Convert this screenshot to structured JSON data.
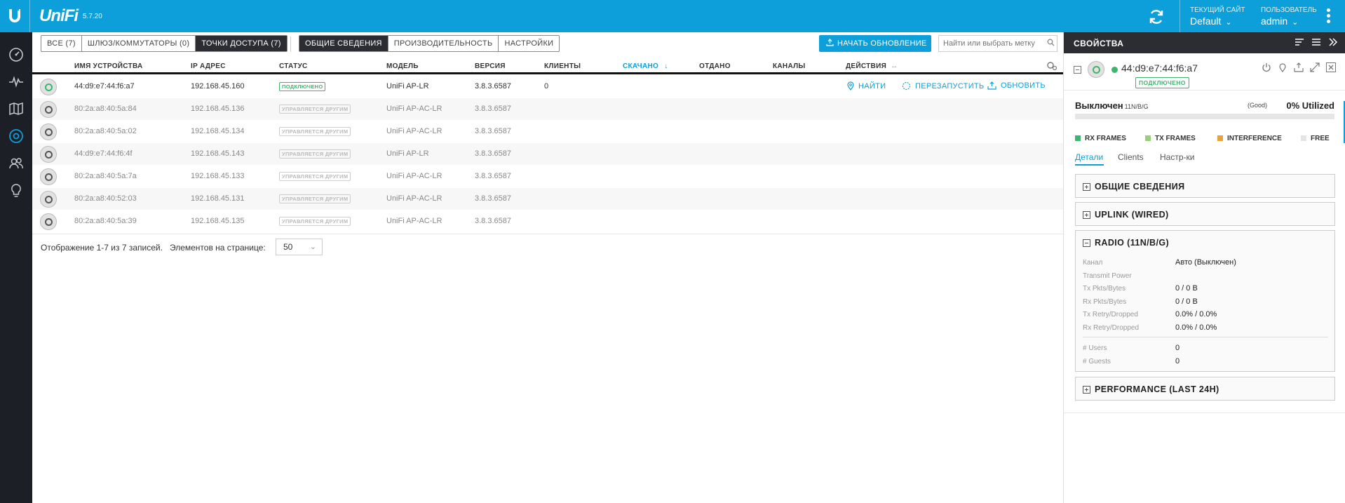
{
  "header": {
    "brand": "UniFi",
    "version": "5.7.20",
    "site_label": "ТЕКУЩИЙ САЙТ",
    "site_value": "Default",
    "user_label": "ПОЛЬЗОВАТЕЛЬ",
    "user_value": "admin"
  },
  "filters": [
    {
      "label": "ВСЕ (7)",
      "active": false
    },
    {
      "label": "ШЛЮЗ/КОММУТАТОРЫ (0)",
      "active": false
    },
    {
      "label": "ТОЧКИ ДОСТУПА (7)",
      "active": true
    }
  ],
  "views": [
    {
      "label": "ОБЩИЕ СВЕДЕНИЯ",
      "active": true
    },
    {
      "label": "ПРОИЗВОДИТЕЛЬНОСТЬ",
      "active": false
    },
    {
      "label": "НАСТРОЙКИ",
      "active": false
    }
  ],
  "toolbar": {
    "upgrade_label": "НАЧАТЬ ОБНОВЛЕНИЕ",
    "search_placeholder": "Найти или выбрать метку"
  },
  "columns": {
    "name": "ИМЯ УСТРОЙСТВА",
    "ip": "IP АДРЕС",
    "status": "СТАТУС",
    "model": "МОДЕЛЬ",
    "version": "ВЕРСИЯ",
    "clients": "КЛИЕНТЫ",
    "downloaded": "СКАЧАНО",
    "sent": "ОТДАНО",
    "channels": "КАНАЛЫ",
    "actions": "ДЕЙСТВИЯ"
  },
  "rows": [
    {
      "name": "44:d9:e7:44:f6:a7",
      "ip": "192.168.45.160",
      "status": "ПОДКЛЮЧЕНО",
      "connected": true,
      "model": "UniFi AP-LR",
      "version": "3.8.3.6587",
      "clients": "0"
    },
    {
      "name": "80:2a:a8:40:5a:84",
      "ip": "192.168.45.136",
      "status": "УПРАВЛЯЕТСЯ ДРУГИМ",
      "connected": false,
      "model": "UniFi AP-AC-LR",
      "version": "3.8.3.6587",
      "clients": ""
    },
    {
      "name": "80:2a:a8:40:5a:02",
      "ip": "192.168.45.134",
      "status": "УПРАВЛЯЕТСЯ ДРУГИМ",
      "connected": false,
      "model": "UniFi AP-AC-LR",
      "version": "3.8.3.6587",
      "clients": ""
    },
    {
      "name": "44:d9:e7:44:f6:4f",
      "ip": "192.168.45.143",
      "status": "УПРАВЛЯЕТСЯ ДРУГИМ",
      "connected": false,
      "model": "UniFi AP-LR",
      "version": "3.8.3.6587",
      "clients": ""
    },
    {
      "name": "80:2a:a8:40:5a:7a",
      "ip": "192.168.45.133",
      "status": "УПРАВЛЯЕТСЯ ДРУГИМ",
      "connected": false,
      "model": "UniFi AP-AC-LR",
      "version": "3.8.3.6587",
      "clients": ""
    },
    {
      "name": "80:2a:a8:40:52:03",
      "ip": "192.168.45.131",
      "status": "УПРАВЛЯЕТСЯ ДРУГИМ",
      "connected": false,
      "model": "UniFi AP-AC-LR",
      "version": "3.8.3.6587",
      "clients": ""
    },
    {
      "name": "80:2a:a8:40:5a:39",
      "ip": "192.168.45.135",
      "status": "УПРАВЛЯЕТСЯ ДРУГИМ",
      "connected": false,
      "model": "UniFi AP-AC-LR",
      "version": "3.8.3.6587",
      "clients": ""
    }
  ],
  "row_actions": {
    "locate": "НАЙТИ",
    "restart": "ПЕРЕЗАПУСТИТЬ",
    "upgrade": "ОБНОВИТЬ"
  },
  "pager": {
    "summary": "Отображение 1-7 из 7 записей.",
    "per_page_label": "Элементов на странице:",
    "per_page_value": "50"
  },
  "panel": {
    "title": "СВОЙСТВА",
    "device_mac": "44:d9:e7:44:f6:a7",
    "device_status": "ПОДКЛЮЧЕНО",
    "radio_state": "Выключен",
    "radio_band": "11N/B/G",
    "quality": "(Good)",
    "utilization": "0% Utilized",
    "utilization_value": 0,
    "legend": [
      {
        "label": "RX FRAMES",
        "color": "#3db56c"
      },
      {
        "label": "TX FRAMES",
        "color": "#9ad07a"
      },
      {
        "label": "INTERFERENCE",
        "color": "#e8a23a"
      },
      {
        "label": "FREE",
        "color": "#e4e4e4"
      }
    ],
    "tabs": [
      "Детали",
      "Clients",
      "Настр-ки"
    ],
    "sections": {
      "overview": "ОБЩИЕ СВЕДЕНИЯ",
      "uplink": "UPLINK (WIRED)",
      "radio": "RADIO (11N/B/G)",
      "performance": "PERFORMANCE (LAST 24H)"
    },
    "radio_details": [
      {
        "key": "Канал",
        "value": "Авто (Выключен)"
      },
      {
        "key": "Transmit Power",
        "value": ""
      },
      {
        "key": "Tx Pkts/Bytes",
        "value": "0 / 0 B"
      },
      {
        "key": "Rx Pkts/Bytes",
        "value": "0 / 0 B"
      },
      {
        "key": "Tx Retry/Dropped",
        "value": "0.0% / 0.0%"
      },
      {
        "key": "Rx Retry/Dropped",
        "value": "0.0% / 0.0%"
      }
    ],
    "radio_counts": [
      {
        "key": "# Users",
        "value": "0"
      },
      {
        "key": "# Guests",
        "value": "0"
      }
    ]
  },
  "colors": {
    "accent": "#0d9fda",
    "online": "#3db56c",
    "nav_bg": "#1c1f26"
  }
}
